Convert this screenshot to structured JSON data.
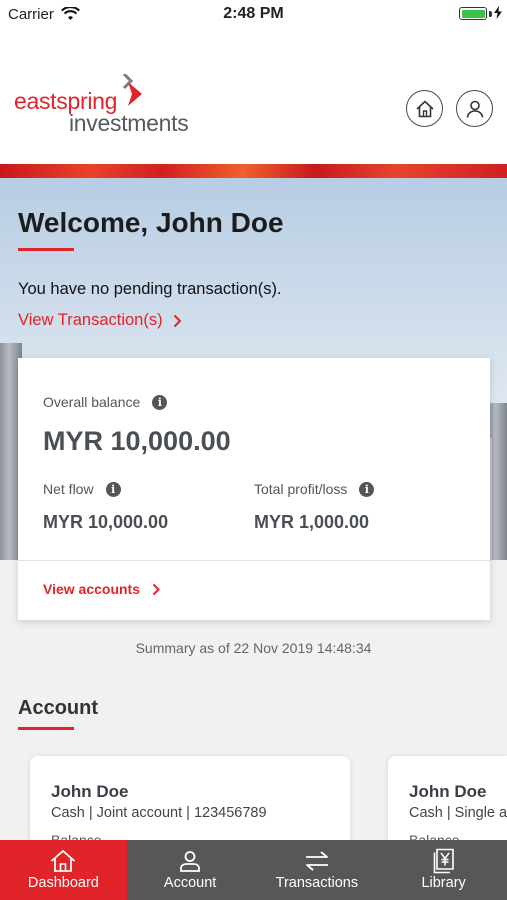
{
  "status_bar": {
    "carrier": "Carrier",
    "time": "2:48 PM",
    "battery_color": "#3cc24a"
  },
  "header": {
    "logo_line1": "eastspring",
    "logo_line2": "investments",
    "home_icon": "home-icon",
    "profile_icon": "user-icon"
  },
  "welcome": {
    "title": "Welcome, John Doe",
    "pending_text": "You have no pending transaction(s).",
    "view_transactions_label": "View Transaction(s)"
  },
  "balance_card": {
    "overall_label": "Overall balance",
    "overall_value": "MYR 10,000.00",
    "netflow_label": "Net flow",
    "netflow_value": "MYR 10,000.00",
    "profit_label": "Total profit/loss",
    "profit_value": "MYR 1,000.00",
    "view_accounts_label": "View accounts"
  },
  "summary_text": "Summary as of 22 Nov 2019 14:48:34",
  "account_section": {
    "title": "Account",
    "cards": [
      {
        "name": "John Doe",
        "detail": "Cash | Joint account | 123456789",
        "balance_label": "Balance"
      },
      {
        "name": "John Doe",
        "detail": "Cash | Single account",
        "balance_label": "Balance"
      }
    ]
  },
  "tab_bar": {
    "tabs": [
      {
        "label": "Dashboard",
        "icon": "home-icon",
        "active": true
      },
      {
        "label": "Account",
        "icon": "user-icon",
        "active": false
      },
      {
        "label": "Transactions",
        "icon": "transfer-arrows-icon",
        "active": false
      },
      {
        "label": "Library",
        "icon": "document-yen-icon",
        "active": false
      }
    ]
  },
  "colors": {
    "brand_red": "#e0242a",
    "tab_bar_bg": "#555759",
    "text_dark": "#4a4f55"
  }
}
